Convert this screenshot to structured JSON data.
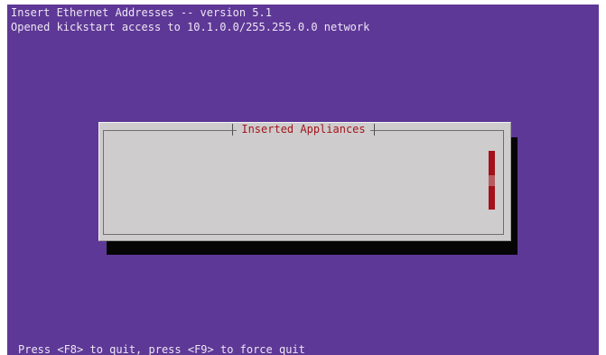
{
  "screen": {
    "header_line_1": "Insert Ethernet Addresses -- version 5.1",
    "header_line_2": "Opened kickstart access to 10.1.0.0/255.255.0.0 network",
    "footer": "Press <F8> to quit, press <F9> to force quit"
  },
  "dialog": {
    "title": "Inserted Appliances",
    "items": [],
    "scroll_position": 0.5
  },
  "colors": {
    "background": "#5e3896",
    "dialog": "#cecccc",
    "title_text": "#a4141c",
    "scrollbar": "#a3121a"
  }
}
